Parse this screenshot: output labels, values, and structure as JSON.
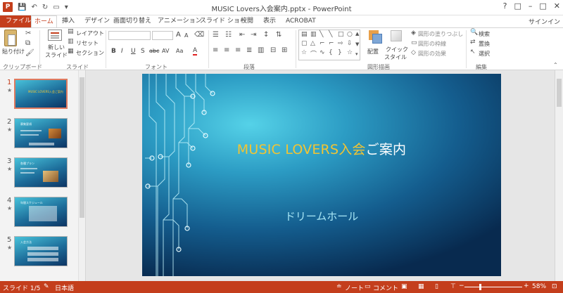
{
  "window": {
    "title": "MUSIC Lovers入会案内.pptx - PowerPoint",
    "controls": [
      "?",
      "□",
      "–",
      "□",
      "✕"
    ]
  },
  "ribbon_tabs": [
    {
      "label": "ファイル"
    },
    {
      "label": "ホーム"
    },
    {
      "label": "挿入"
    },
    {
      "label": "デザイン"
    },
    {
      "label": "画面切り替え"
    },
    {
      "label": "アニメーション"
    },
    {
      "label": "スライド ショー"
    },
    {
      "label": "校閲"
    },
    {
      "label": "表示"
    },
    {
      "label": "ACROBAT"
    }
  ],
  "signin": "サインイン",
  "clipboard": {
    "paste": "貼り付け",
    "group": "クリップボード"
  },
  "slides_group": {
    "new_slide": "新しい",
    "new_slide2": "スライド",
    "layout": "レイアウト",
    "reset": "リセット",
    "section": "セクション",
    "group": "スライド"
  },
  "font_group": {
    "group": "フォント",
    "bold": "B",
    "italic": "I",
    "underline": "U",
    "shadow": "S",
    "strike": "abc",
    "spacing": "AV",
    "case": "Aa",
    "color": "A",
    "grow": "A",
    "shrink": "A"
  },
  "paragraph_group": {
    "group": "段落"
  },
  "drawing_group": {
    "group": "図形描画",
    "arrange": "配置",
    "quick_style": "クイック",
    "quick_style2": "スタイル",
    "shape_fill": "図形の塗りつぶし",
    "shape_outline": "図形の枠線",
    "shape_effect": "図形の効果"
  },
  "editing_group": {
    "group": "編集",
    "find": "検索",
    "replace": "置換",
    "select": "選択"
  },
  "thumbnails": {
    "numbers": [
      "1",
      "2",
      "3",
      "4",
      "5"
    ],
    "star": "★",
    "t1_title": "MUSIC LOVERS入会ご案内",
    "t2_title": "募集要項",
    "t3_title": "各種プラン",
    "t4_title": "年間スケジュール",
    "t5_title": "入会方法"
  },
  "slide": {
    "title_highlight": "MUSIC LOVERS入会",
    "title_rest": "ご案内",
    "subtitle": "ドリームホール"
  },
  "status_bar": {
    "slide_pos": "スライド 1/5",
    "language": "日本語",
    "notes": "ノート",
    "comments": "コメント",
    "zoom": "58%",
    "zoom_value": 58
  },
  "colors": {
    "accent": "#c43e1c",
    "title_highlight": "#f2c433",
    "subtitle": "#a7e6f5"
  }
}
